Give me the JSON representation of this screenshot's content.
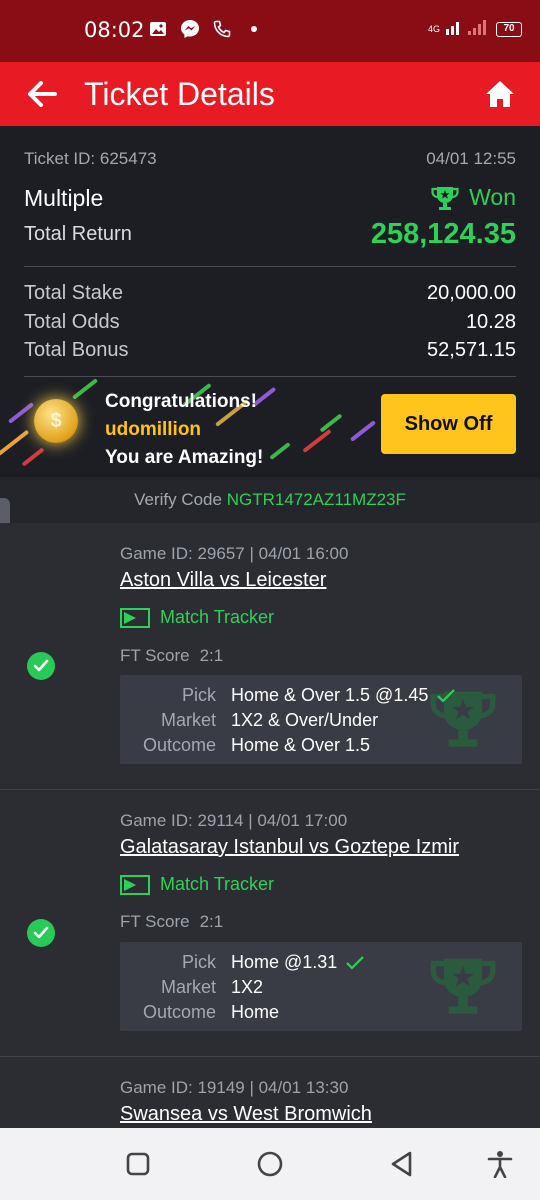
{
  "status_bar": {
    "time": "08:02",
    "network_type": "4G",
    "battery": "70"
  },
  "header": {
    "title": "Ticket Details",
    "back_icon": "arrow-left-icon",
    "home_icon": "home-icon"
  },
  "ticket": {
    "id_label": "Ticket ID: 625473",
    "date": "04/01 12:55",
    "type": "Multiple",
    "status": "Won",
    "total_return_label": "Total Return",
    "total_return_value": "258,124.35",
    "stake_label": "Total Stake",
    "stake_value": "20,000.00",
    "odds_label": "Total Odds",
    "odds_value": "10.28",
    "bonus_label": "Total Bonus",
    "bonus_value": "52,571.15"
  },
  "congrats": {
    "line1": "Congratulations!",
    "username": "udomillion",
    "line3": "You are Amazing!",
    "button_label": "Show Off"
  },
  "verify": {
    "label": "Verify Code",
    "code": "NGTR1472AZ11MZ23F"
  },
  "games": [
    {
      "meta": "Game ID: 29657 | 04/01 16:00",
      "teams": "Aston Villa vs Leicester",
      "tracker_label": "Match Tracker",
      "ft_label": "FT Score",
      "ft_score": "2:1",
      "pick_label": "Pick",
      "pick": "Home & Over 1.5 @1.45",
      "market_label": "Market",
      "market": "1X2 & Over/Under",
      "outcome_label": "Outcome",
      "outcome": "Home & Over 1.5"
    },
    {
      "meta": "Game ID: 29114 | 04/01 17:00",
      "teams": "Galatasaray Istanbul vs Goztepe Izmir",
      "tracker_label": "Match Tracker",
      "ft_label": "FT Score",
      "ft_score": "2:1",
      "pick_label": "Pick",
      "pick": "Home @1.31",
      "market_label": "Market",
      "market": "1X2",
      "outcome_label": "Outcome",
      "outcome": "Home"
    },
    {
      "meta": "Game ID: 19149 | 04/01 13:30",
      "teams": "Swansea vs West Bromwich"
    }
  ],
  "colors": {
    "header_red": "#e81a24",
    "status_bar": "#8a0d16",
    "win_green": "#2ed158",
    "button_yellow": "#ffc51d",
    "username_gold": "#ffc21a"
  }
}
